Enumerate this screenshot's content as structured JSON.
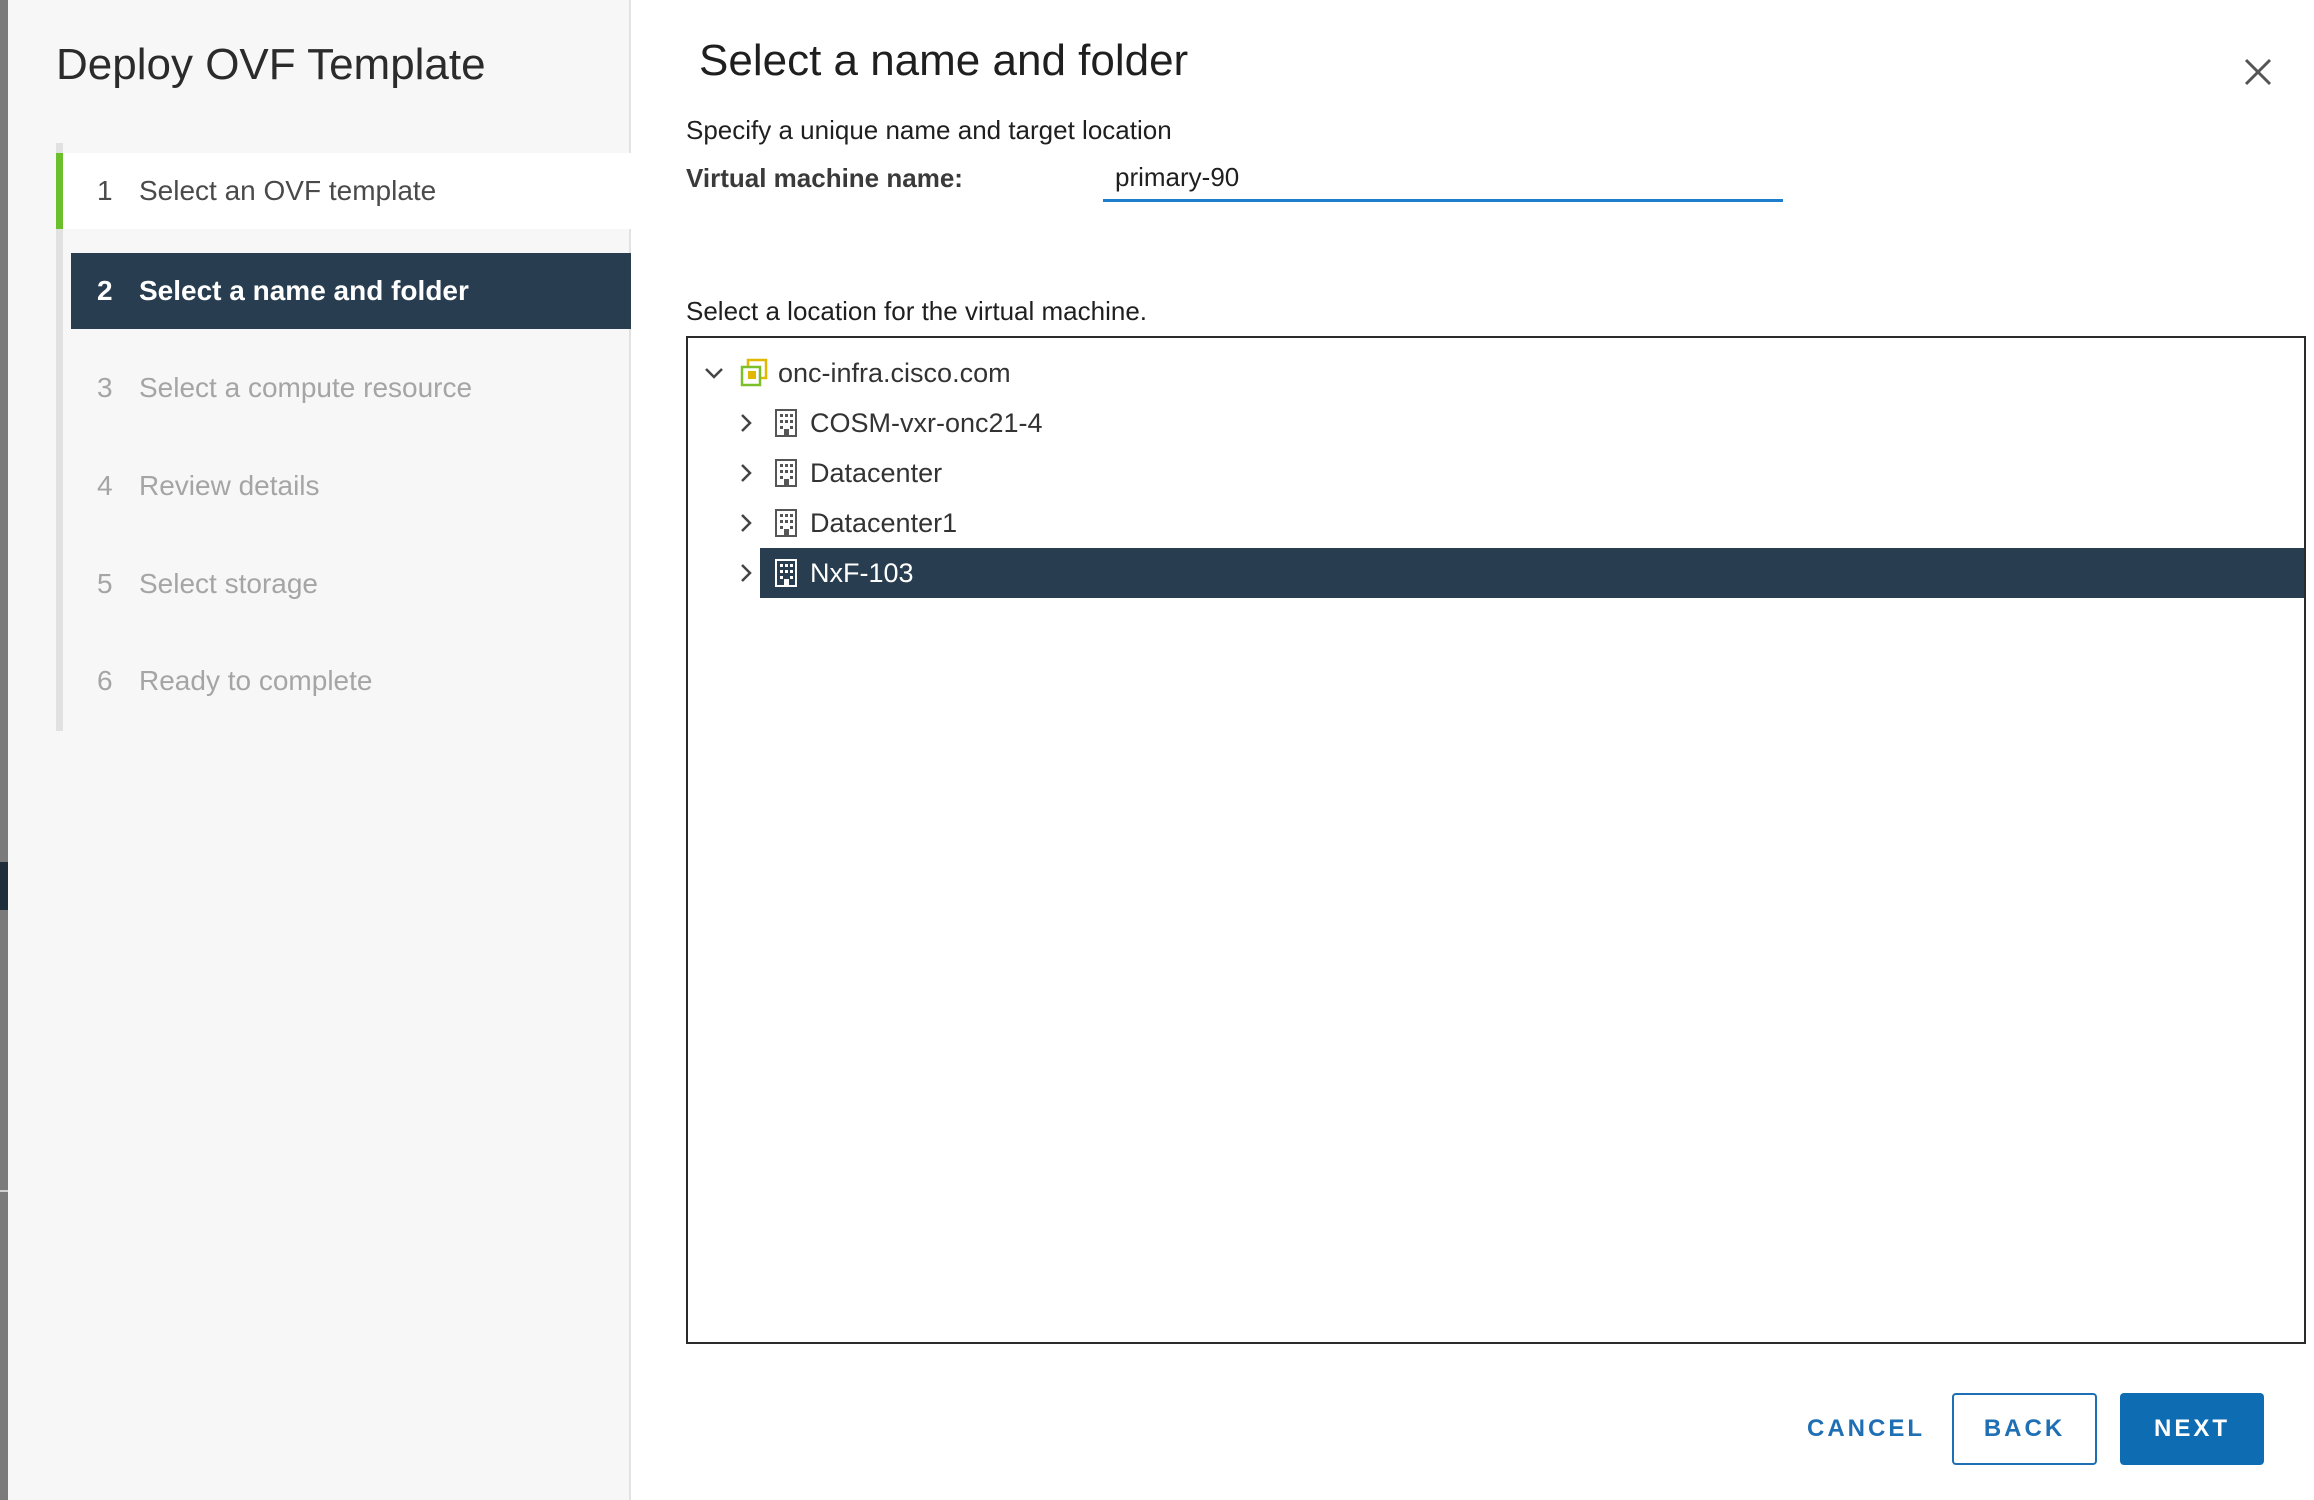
{
  "wizard": {
    "title": "Deploy OVF Template",
    "steps": [
      {
        "num": "1",
        "label": "Select an OVF template",
        "state": "done"
      },
      {
        "num": "2",
        "label": "Select a name and folder",
        "state": "active"
      },
      {
        "num": "3",
        "label": "Select a compute resource",
        "state": "pending"
      },
      {
        "num": "4",
        "label": "Review details",
        "state": "pending"
      },
      {
        "num": "5",
        "label": "Select storage",
        "state": "pending"
      },
      {
        "num": "6",
        "label": "Ready to complete",
        "state": "pending"
      }
    ]
  },
  "page": {
    "title": "Select a name and folder",
    "subtitle": "Specify a unique name and target location",
    "vm_name_label": "Virtual machine name:",
    "vm_name_value": "primary-90",
    "location_label": "Select a location for the virtual machine."
  },
  "tree": {
    "root": {
      "label": "onc-infra.cisco.com",
      "icon": "vcenter-icon",
      "expanded": true
    },
    "children": [
      {
        "label": "COSM-vxr-onc21-4",
        "icon": "datacenter-icon",
        "selected": false
      },
      {
        "label": "Datacenter",
        "icon": "datacenter-icon",
        "selected": false
      },
      {
        "label": "Datacenter1",
        "icon": "datacenter-icon",
        "selected": false
      },
      {
        "label": "NxF-103",
        "icon": "datacenter-icon",
        "selected": true
      }
    ]
  },
  "buttons": {
    "cancel": "CANCEL",
    "back": "BACK",
    "next": "NEXT"
  },
  "colors": {
    "accent": "#0d6cb2",
    "selected_bg": "#283d4f",
    "step_done": "#6bbf2a"
  }
}
